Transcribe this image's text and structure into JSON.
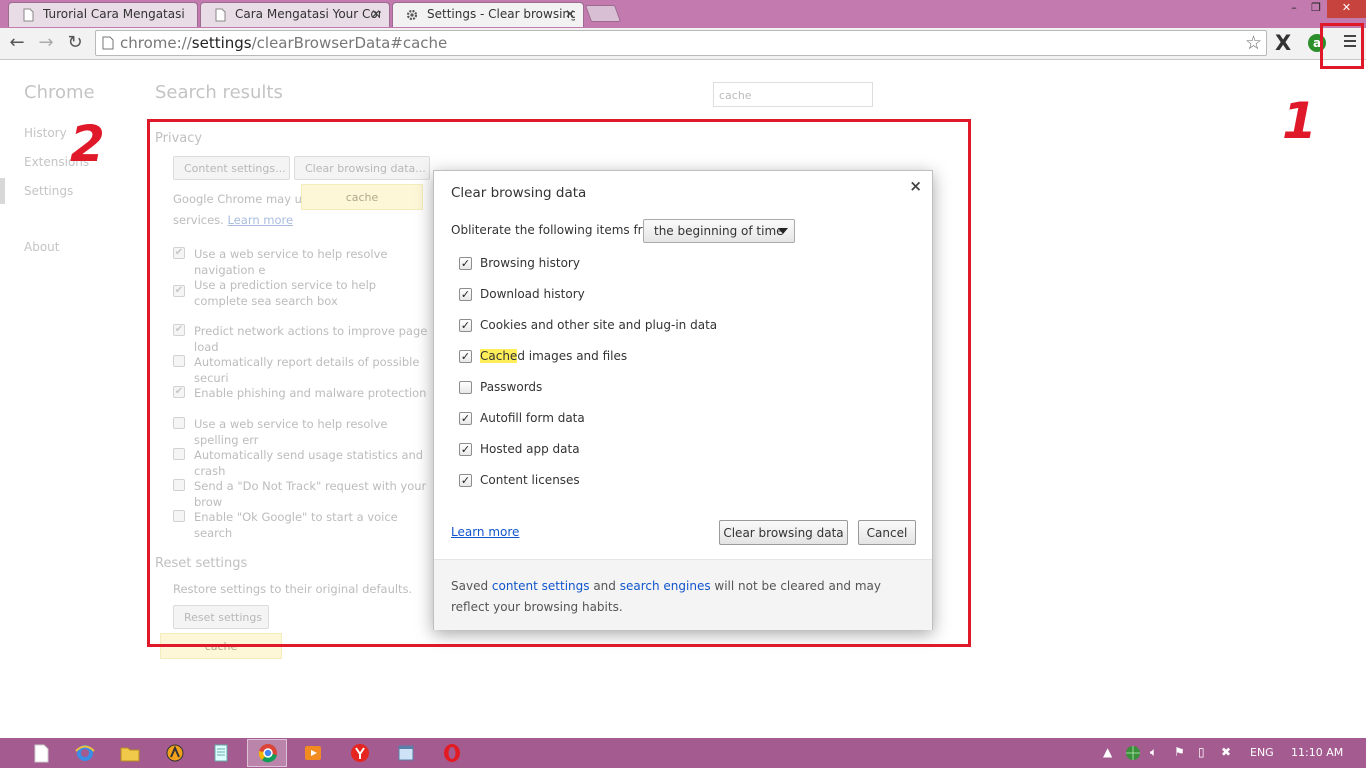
{
  "window": {
    "tabs": [
      {
        "label": "Turorial Cara Mengatasi C",
        "icon": "page-icon"
      },
      {
        "label": "Cara Mengatasi Your Conr",
        "icon": "page-icon"
      },
      {
        "label": "Settings - Clear browsing d",
        "icon": "gear-icon"
      }
    ],
    "controls": {
      "minimize": "–",
      "maximize": "❐",
      "close": "✕"
    }
  },
  "toolbar": {
    "url_scheme": "chrome://",
    "url_host": "settings",
    "url_path": "/clearBrowserData#cache",
    "star": "☆",
    "ext_x": "X",
    "ext_circle": "a"
  },
  "sidebar": {
    "title": "Chrome",
    "items": [
      "History",
      "Extensions",
      "Settings",
      "About"
    ]
  },
  "main": {
    "title": "Search results",
    "search_placeholder": "cache",
    "privacy": {
      "title": "Privacy",
      "content_settings_btn": "Content settings...",
      "clear_data_btn": "Clear browsing data...",
      "bubble": "cache",
      "desc_1": "Google Chrome may use",
      "desc_2_prefix": "services.",
      "learn_more": "Learn more",
      "checks": [
        {
          "label": "Use a web service to help resolve navigation e",
          "checked": true
        },
        {
          "label": "Use a prediction service to help complete sea search box",
          "checked": true
        },
        {
          "label": "Predict network actions to improve page load",
          "checked": true
        },
        {
          "label": "Automatically report details of possible securi",
          "checked": false
        },
        {
          "label": "Enable phishing and malware protection",
          "checked": true
        },
        {
          "label": "Use a web service to help resolve spelling err",
          "checked": false
        },
        {
          "label": "Automatically send usage statistics and crash",
          "checked": false
        },
        {
          "label": "Send a \"Do Not Track\" request with your brow",
          "checked": false
        },
        {
          "label": "Enable \"Ok Google\" to start a voice search",
          "checked": false
        }
      ]
    },
    "reset": {
      "title": "Reset settings",
      "desc": "Restore settings to their original defaults.",
      "button": "Reset settings",
      "bubble": "cache"
    }
  },
  "dialog": {
    "title": "Clear browsing data",
    "close": "×",
    "obliterate_label": "Obliterate the following items from:",
    "time_range": "the beginning of time",
    "options": [
      {
        "label": "Browsing history",
        "checked": true
      },
      {
        "label": "Download history",
        "checked": true
      },
      {
        "label": "Cookies and other site and plug-in data",
        "checked": true
      },
      {
        "label_hl": "Cache",
        "label_rest": "d images and files",
        "checked": true
      },
      {
        "label": "Passwords",
        "checked": false
      },
      {
        "label": "Autofill form data",
        "checked": true
      },
      {
        "label": "Hosted app data",
        "checked": true
      },
      {
        "label": "Content licenses",
        "checked": true
      }
    ],
    "learn_more": "Learn more",
    "clear_button": "Clear browsing data",
    "cancel_button": "Cancel",
    "footer": {
      "t1": "Saved ",
      "link1": "content settings",
      "t2": " and ",
      "link2": "search engines",
      "t3": " will not be cleared and may reflect your browsing habits."
    }
  },
  "annotations": {
    "one": "1",
    "two": "2",
    "color": "#e0192a"
  },
  "taskbar": {
    "lang": "ENG",
    "time": "11:10 AM"
  }
}
